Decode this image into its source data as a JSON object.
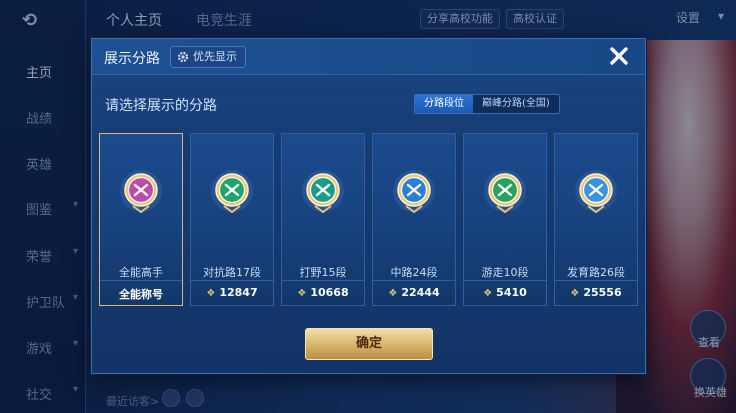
{
  "background": {
    "sidebar": [
      "主页",
      "战绩",
      "英雄",
      "图鉴",
      "荣誉",
      "护卫队",
      "游戏",
      "社交"
    ],
    "top_tabs": [
      "个人主页",
      "电竞生涯"
    ],
    "top_pills": [
      "分享高校功能",
      "高校认证"
    ],
    "settings_label": "设置",
    "bottom_text": "最近访客>",
    "right_labels": [
      "查看",
      "换英雄"
    ]
  },
  "modal": {
    "title": "展示分路",
    "priority_label": "优先显示",
    "subtitle": "请选择展示的分路",
    "segments": [
      "分路段位",
      "巅峰分路(全国)"
    ],
    "active_segment": 0,
    "cards": [
      {
        "name": "全能高手",
        "value": "全能称号",
        "icon": "all-round-emblem-icon",
        "selected": true,
        "color": "#c04aa8"
      },
      {
        "name": "对抗路17段",
        "value": "12847",
        "icon": "clash-lane-emblem-icon",
        "selected": false,
        "color": "#1fa56a"
      },
      {
        "name": "打野15段",
        "value": "10668",
        "icon": "jungle-emblem-icon",
        "selected": false,
        "color": "#1a9c8a"
      },
      {
        "name": "中路24段",
        "value": "22444",
        "icon": "mid-lane-emblem-icon",
        "selected": false,
        "color": "#2a7fd6"
      },
      {
        "name": "游走10段",
        "value": "5410",
        "icon": "roam-emblem-icon",
        "selected": false,
        "color": "#28a25a"
      },
      {
        "name": "发育路26段",
        "value": "25556",
        "icon": "farm-lane-emblem-icon",
        "selected": false,
        "color": "#3a92e0"
      }
    ],
    "confirm_label": "确定"
  }
}
